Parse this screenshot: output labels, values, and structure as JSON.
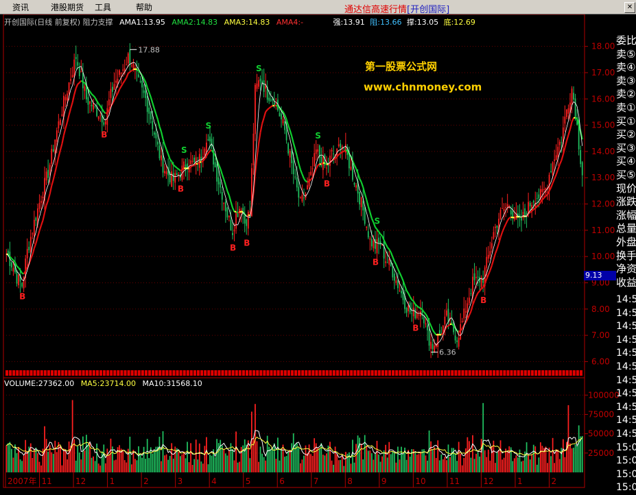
{
  "menu": {
    "items": [
      "资讯",
      "港股期货",
      "工具",
      "帮助"
    ],
    "app_title": "通达信高速行情",
    "broker": "[开创国际]"
  },
  "header": {
    "stock_label": "开创国际(日线 前复权) 阻力支撑",
    "ama1": "AMA1:13.95",
    "ama2": "AMA2:14.83",
    "ama3": "AMA3:14.83",
    "ama4": "AMA4:-",
    "strong": "强:13.91",
    "resist": "阻:13.66",
    "support": "撑:13.05",
    "bottom": "底:12.69"
  },
  "watermark": {
    "line1": "第一股票公式网",
    "line2": "www.chnmoney.com"
  },
  "volume_header": {
    "volume": "VOLUME:27362.00",
    "ma5": "MA5:23714.00",
    "ma10": "MA10:31568.10"
  },
  "side_panel": {
    "items": [
      "委比",
      "卖⑤",
      "卖④",
      "卖③",
      "卖②",
      "卖①",
      "买①",
      "买②",
      "买③",
      "买④",
      "买⑤",
      "现价",
      "涨跌",
      "涨幅",
      "总量",
      "外盘",
      "换手",
      "净资",
      "收益"
    ],
    "time_items": [
      "14:5",
      "14:5",
      "14:5",
      "14:5",
      "14:5",
      "14:5",
      "14:5",
      "14:5",
      "14:5",
      "14:5",
      "14:5",
      "15:0",
      "15:0",
      "15:0",
      "15:0"
    ]
  },
  "last_price": "9.13",
  "colors": {
    "up": "#ff2020",
    "down": "#20c060",
    "ama_red": "#e01010",
    "ama_green": "#10d030",
    "ama_yellow": "#ffff40",
    "axis": "#b00000",
    "grid": "#6a0000"
  },
  "chart_data": {
    "type": "candlestick",
    "price_axis": {
      "ticks": [
        6.0,
        7.0,
        8.0,
        9.0,
        10.0,
        11.0,
        12.0,
        13.0,
        14.0,
        15.0,
        16.0,
        17.0,
        18.0
      ],
      "ylim": [
        5.75,
        18.2
      ]
    },
    "volume_axis": {
      "ticks": [
        25000,
        50000,
        75000,
        100000
      ],
      "ylim": [
        0,
        110000
      ]
    },
    "x_labels": [
      "2007年",
      "11",
      "12",
      "1",
      "2",
      "3",
      "4",
      "5",
      "6",
      "7",
      "8",
      "9",
      "10",
      "11",
      "12",
      "1",
      "2"
    ],
    "annotations": [
      {
        "label": "17.88",
        "price": 17.88
      },
      {
        "label": "6.36",
        "price": 6.36
      }
    ],
    "signals": {
      "buy": "B",
      "sell": "S"
    },
    "anchors": [
      [
        0,
        10.1
      ],
      [
        4,
        9.6
      ],
      [
        6,
        9.2
      ],
      [
        9,
        8.9
      ],
      [
        12,
        10.2
      ],
      [
        16,
        11.3
      ],
      [
        20,
        12.3
      ],
      [
        24,
        13.2
      ],
      [
        28,
        14.5
      ],
      [
        32,
        15.6
      ],
      [
        36,
        16.6
      ],
      [
        40,
        17.6
      ],
      [
        42,
        17.1
      ],
      [
        46,
        16.0
      ],
      [
        50,
        15.7
      ],
      [
        54,
        15.4
      ],
      [
        57,
        15.2
      ],
      [
        59,
        15.9
      ],
      [
        62,
        16.6
      ],
      [
        66,
        17.0
      ],
      [
        70,
        17.6
      ],
      [
        72,
        17.4
      ],
      [
        76,
        16.6
      ],
      [
        80,
        16.0
      ],
      [
        83,
        15.3
      ],
      [
        86,
        14.4
      ],
      [
        89,
        13.6
      ],
      [
        92,
        13.2
      ],
      [
        96,
        12.9
      ],
      [
        100,
        13.2
      ],
      [
        104,
        13.6
      ],
      [
        108,
        13.5
      ],
      [
        112,
        13.8
      ],
      [
        115,
        14.6
      ],
      [
        118,
        14.0
      ],
      [
        121,
        13.1
      ],
      [
        124,
        12.4
      ],
      [
        127,
        11.6
      ],
      [
        130,
        11.0
      ],
      [
        132,
        11.6
      ],
      [
        135,
        12.0
      ],
      [
        137,
        11.3
      ],
      [
        140,
        11.7
      ],
      [
        143,
        16.3
      ],
      [
        146,
        16.8
      ],
      [
        150,
        16.2
      ],
      [
        154,
        16.0
      ],
      [
        157,
        15.4
      ],
      [
        160,
        14.8
      ],
      [
        163,
        13.8
      ],
      [
        166,
        12.8
      ],
      [
        169,
        12.0
      ],
      [
        172,
        12.4
      ],
      [
        175,
        13.0
      ],
      [
        178,
        14.0
      ],
      [
        181,
        13.7
      ],
      [
        184,
        13.3
      ],
      [
        187,
        13.9
      ],
      [
        190,
        13.9
      ],
      [
        192,
        14.4
      ],
      [
        195,
        14.0
      ],
      [
        199,
        13.1
      ],
      [
        202,
        12.5
      ],
      [
        206,
        11.5
      ],
      [
        209,
        10.6
      ],
      [
        212,
        10.4
      ],
      [
        215,
        10.5
      ],
      [
        218,
        9.9
      ],
      [
        221,
        9.6
      ],
      [
        224,
        9.1
      ],
      [
        227,
        8.6
      ],
      [
        230,
        8.1
      ],
      [
        233,
        7.8
      ],
      [
        236,
        7.9
      ],
      [
        239,
        8.0
      ],
      [
        242,
        7.0
      ],
      [
        245,
        6.6
      ],
      [
        248,
        6.9
      ],
      [
        251,
        7.3
      ],
      [
        253,
        7.7
      ],
      [
        256,
        7.3
      ],
      [
        259,
        6.9
      ],
      [
        262,
        7.5
      ],
      [
        265,
        8.3
      ],
      [
        268,
        9.0
      ],
      [
        271,
        9.1
      ],
      [
        274,
        9.2
      ],
      [
        277,
        10.0
      ],
      [
        280,
        10.9
      ],
      [
        283,
        11.5
      ],
      [
        286,
        11.8
      ],
      [
        289,
        12.0
      ],
      [
        292,
        11.5
      ],
      [
        295,
        11.3
      ],
      [
        298,
        11.6
      ],
      [
        301,
        12.0
      ],
      [
        304,
        12.3
      ],
      [
        307,
        12.3
      ],
      [
        310,
        12.6
      ],
      [
        313,
        13.4
      ],
      [
        316,
        14.0
      ],
      [
        319,
        14.5
      ],
      [
        322,
        15.6
      ],
      [
        325,
        16.4
      ],
      [
        327,
        15.6
      ],
      [
        329,
        14.3
      ],
      [
        331,
        13.2
      ]
    ]
  }
}
